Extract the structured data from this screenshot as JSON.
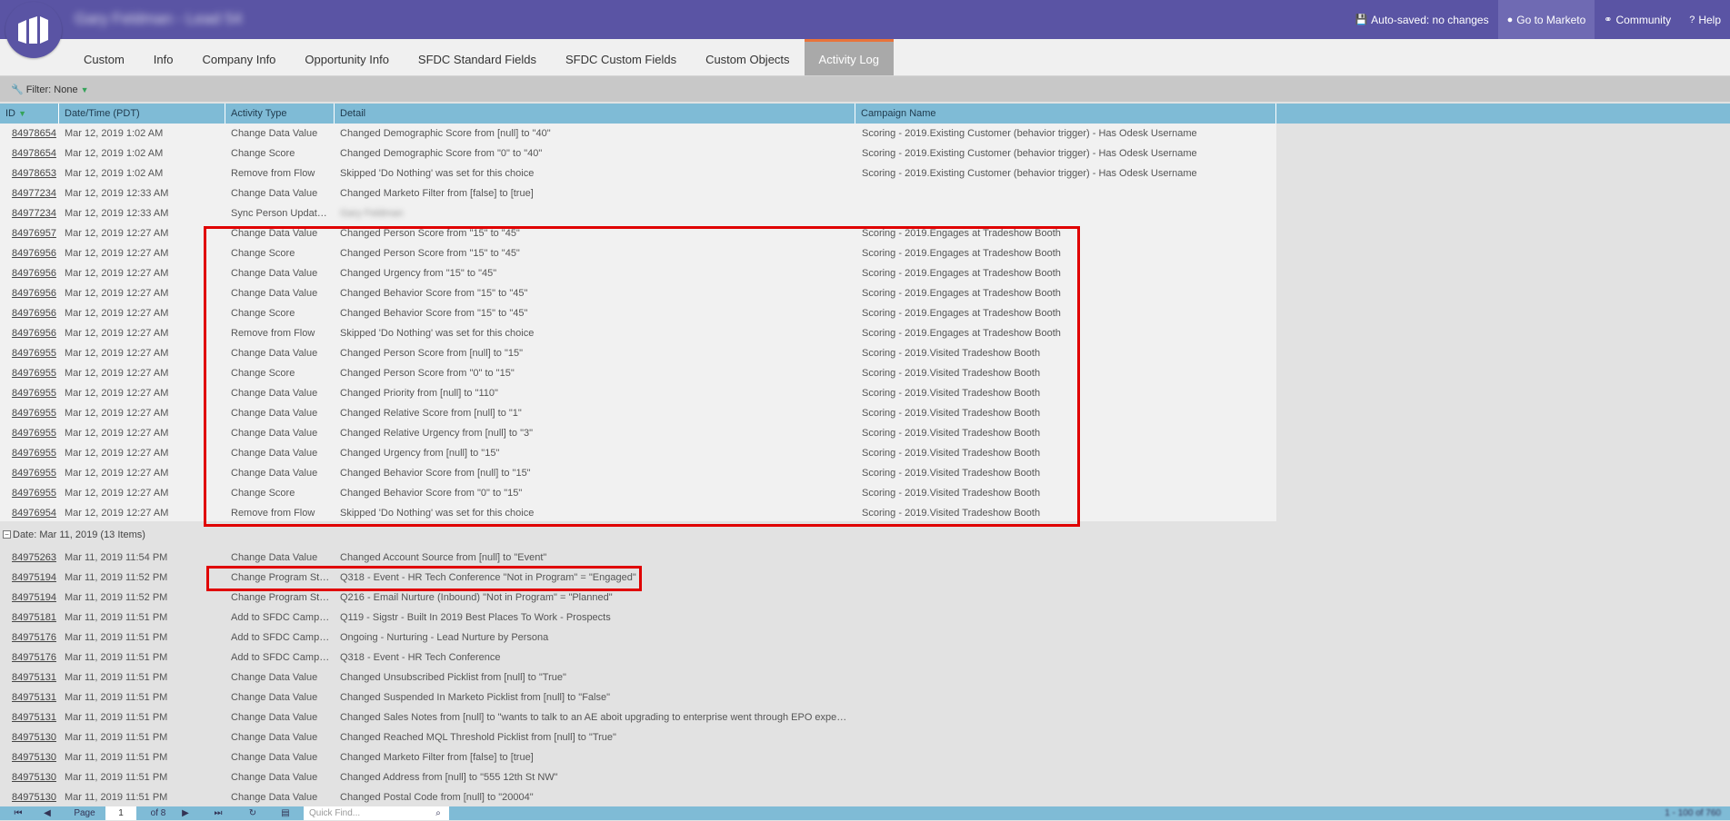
{
  "header": {
    "title": "Gary Feldman - Lead 54",
    "actions": [
      {
        "icon": "save-icon",
        "glyph": "💾",
        "label": "Auto-saved: no changes"
      },
      {
        "icon": "globe-icon",
        "glyph": "●",
        "label": "Go to Marketo"
      },
      {
        "icon": "community-icon",
        "glyph": "⚭",
        "label": "Community"
      },
      {
        "icon": "help-icon",
        "glyph": "?",
        "label": "Help"
      }
    ]
  },
  "tabs": [
    "Custom",
    "Info",
    "Company Info",
    "Opportunity Info",
    "SFDC Standard Fields",
    "SFDC Custom Fields",
    "Custom Objects",
    "Activity Log"
  ],
  "active_tab": "Activity Log",
  "filter": {
    "label": "Filter: None"
  },
  "columns": [
    "ID",
    "Date/Time (PDT)",
    "Activity Type",
    "Detail",
    "Campaign Name"
  ],
  "rows_top": [
    {
      "id": "84978654",
      "dt": "Mar 12, 2019 1:02 AM",
      "type": "Change Data Value",
      "detail": "Changed Demographic Score from [null] to \"40\"",
      "campaign": "Scoring - 2019.Existing Customer (behavior trigger) - Has Odesk Username"
    },
    {
      "id": "84978654",
      "dt": "Mar 12, 2019 1:02 AM",
      "type": "Change Score",
      "detail": "Changed Demographic Score from \"0\" to \"40\"",
      "campaign": "Scoring - 2019.Existing Customer (behavior trigger) - Has Odesk Username"
    },
    {
      "id": "84978653",
      "dt": "Mar 12, 2019 1:02 AM",
      "type": "Remove from Flow",
      "detail": "Skipped 'Do Nothing' was set for this choice",
      "campaign": "Scoring - 2019.Existing Customer (behavior trigger) - Has Odesk Username"
    },
    {
      "id": "84977234",
      "dt": "Mar 12, 2019 12:33 AM",
      "type": "Change Data Value",
      "detail": "Changed Marketo Filter from [false] to [true]",
      "campaign": ""
    },
    {
      "id": "84977234",
      "dt": "Mar 12, 2019 12:33 AM",
      "type": "Sync Person Update...",
      "detail": "Gary Feldman",
      "campaign": ""
    },
    {
      "id": "84976957",
      "dt": "Mar 12, 2019 12:27 AM",
      "type": "Change Data Value",
      "detail": "Changed Person Score from \"15\" to \"45\"",
      "campaign": "Scoring - 2019.Engages at Tradeshow Booth"
    },
    {
      "id": "84976956",
      "dt": "Mar 12, 2019 12:27 AM",
      "type": "Change Score",
      "detail": "Changed Person Score from \"15\" to \"45\"",
      "campaign": "Scoring - 2019.Engages at Tradeshow Booth"
    },
    {
      "id": "84976956",
      "dt": "Mar 12, 2019 12:27 AM",
      "type": "Change Data Value",
      "detail": "Changed Urgency from \"15\" to \"45\"",
      "campaign": "Scoring - 2019.Engages at Tradeshow Booth"
    },
    {
      "id": "84976956",
      "dt": "Mar 12, 2019 12:27 AM",
      "type": "Change Data Value",
      "detail": "Changed Behavior Score from \"15\" to \"45\"",
      "campaign": "Scoring - 2019.Engages at Tradeshow Booth"
    },
    {
      "id": "84976956",
      "dt": "Mar 12, 2019 12:27 AM",
      "type": "Change Score",
      "detail": "Changed Behavior Score from \"15\" to \"45\"",
      "campaign": "Scoring - 2019.Engages at Tradeshow Booth"
    },
    {
      "id": "84976956",
      "dt": "Mar 12, 2019 12:27 AM",
      "type": "Remove from Flow",
      "detail": "Skipped 'Do Nothing' was set for this choice",
      "campaign": "Scoring - 2019.Engages at Tradeshow Booth"
    },
    {
      "id": "84976955",
      "dt": "Mar 12, 2019 12:27 AM",
      "type": "Change Data Value",
      "detail": "Changed Person Score from [null] to \"15\"",
      "campaign": "Scoring - 2019.Visited Tradeshow Booth"
    },
    {
      "id": "84976955",
      "dt": "Mar 12, 2019 12:27 AM",
      "type": "Change Score",
      "detail": "Changed Person Score from \"0\" to \"15\"",
      "campaign": "Scoring - 2019.Visited Tradeshow Booth"
    },
    {
      "id": "84976955",
      "dt": "Mar 12, 2019 12:27 AM",
      "type": "Change Data Value",
      "detail": "Changed Priority from [null] to \"110\"",
      "campaign": "Scoring - 2019.Visited Tradeshow Booth"
    },
    {
      "id": "84976955",
      "dt": "Mar 12, 2019 12:27 AM",
      "type": "Change Data Value",
      "detail": "Changed Relative Score from [null] to \"1\"",
      "campaign": "Scoring - 2019.Visited Tradeshow Booth"
    },
    {
      "id": "84976955",
      "dt": "Mar 12, 2019 12:27 AM",
      "type": "Change Data Value",
      "detail": "Changed Relative Urgency from [null] to \"3\"",
      "campaign": "Scoring - 2019.Visited Tradeshow Booth"
    },
    {
      "id": "84976955",
      "dt": "Mar 12, 2019 12:27 AM",
      "type": "Change Data Value",
      "detail": "Changed Urgency from [null] to \"15\"",
      "campaign": "Scoring - 2019.Visited Tradeshow Booth"
    },
    {
      "id": "84976955",
      "dt": "Mar 12, 2019 12:27 AM",
      "type": "Change Data Value",
      "detail": "Changed Behavior Score from [null] to \"15\"",
      "campaign": "Scoring - 2019.Visited Tradeshow Booth"
    },
    {
      "id": "84976955",
      "dt": "Mar 12, 2019 12:27 AM",
      "type": "Change Score",
      "detail": "Changed Behavior Score from \"0\" to \"15\"",
      "campaign": "Scoring - 2019.Visited Tradeshow Booth"
    },
    {
      "id": "84976954",
      "dt": "Mar 12, 2019 12:27 AM",
      "type": "Remove from Flow",
      "detail": "Skipped 'Do Nothing' was set for this choice",
      "campaign": "Scoring - 2019.Visited Tradeshow Booth"
    }
  ],
  "group_label": "Date: Mar 11, 2019 (13 Items)",
  "rows_bottom": [
    {
      "id": "84975263",
      "dt": "Mar 11, 2019 11:54 PM",
      "type": "Change Data Value",
      "detail": "Changed Account Source from [null] to \"Event\"",
      "campaign": ""
    },
    {
      "id": "84975194",
      "dt": "Mar 11, 2019 11:52 PM",
      "type": "Change Program Sta...",
      "detail": "Q318 - Event - HR Tech Conference \"Not in Program\" = \"Engaged\"",
      "campaign": ""
    },
    {
      "id": "84975194",
      "dt": "Mar 11, 2019 11:52 PM",
      "type": "Change Program Sta...",
      "detail": "Q216 - Email Nurture (Inbound) \"Not in Program\" = \"Planned\"",
      "campaign": ""
    },
    {
      "id": "84975181",
      "dt": "Mar 11, 2019 11:51 PM",
      "type": "Add to SFDC Campa...",
      "detail": "Q119 - Sigstr - Built In 2019 Best Places To Work - Prospects",
      "campaign": ""
    },
    {
      "id": "84975176",
      "dt": "Mar 11, 2019 11:51 PM",
      "type": "Add to SFDC Campa...",
      "detail": "Ongoing - Nurturing - Lead Nurture by Persona",
      "campaign": ""
    },
    {
      "id": "84975176",
      "dt": "Mar 11, 2019 11:51 PM",
      "type": "Add to SFDC Campa...",
      "detail": "Q318 - Event - HR Tech Conference",
      "campaign": ""
    },
    {
      "id": "84975131",
      "dt": "Mar 11, 2019 11:51 PM",
      "type": "Change Data Value",
      "detail": "Changed Unsubscribed Picklist from [null] to \"True\"",
      "campaign": ""
    },
    {
      "id": "84975131",
      "dt": "Mar 11, 2019 11:51 PM",
      "type": "Change Data Value",
      "detail": "Changed Suspended In Marketo Picklist from [null] to \"False\"",
      "campaign": ""
    },
    {
      "id": "84975131",
      "dt": "Mar 11, 2019 11:51 PM",
      "type": "Change Data Value",
      "detail": "Changed Sales Notes from [null] to \"wants to talk to an AE aboit upgrading to enterprise went through EPO experi...",
      "campaign": ""
    },
    {
      "id": "84975130",
      "dt": "Mar 11, 2019 11:51 PM",
      "type": "Change Data Value",
      "detail": "Changed Reached MQL Threshold Picklist from [null] to \"True\"",
      "campaign": ""
    },
    {
      "id": "84975130",
      "dt": "Mar 11, 2019 11:51 PM",
      "type": "Change Data Value",
      "detail": "Changed Marketo Filter from [false] to [true]",
      "campaign": ""
    },
    {
      "id": "84975130",
      "dt": "Mar 11, 2019 11:51 PM",
      "type": "Change Data Value",
      "detail": "Changed Address from [null] to \"555 12th St NW\"",
      "campaign": ""
    },
    {
      "id": "84975130",
      "dt": "Mar 11, 2019 11:51 PM",
      "type": "Change Data Value",
      "detail": "Changed Postal Code from [null] to \"20004\"",
      "campaign": ""
    }
  ],
  "bottom": {
    "page": "1",
    "of_pages": "of 8",
    "quick_find_placeholder": "Quick Find...",
    "count": "1 - 100 of 760"
  },
  "colors": {
    "brand": "#5a54a4",
    "grid_header": "#7fbbd6",
    "highlight": "#e00000",
    "active_tab_border": "#e9733a"
  }
}
